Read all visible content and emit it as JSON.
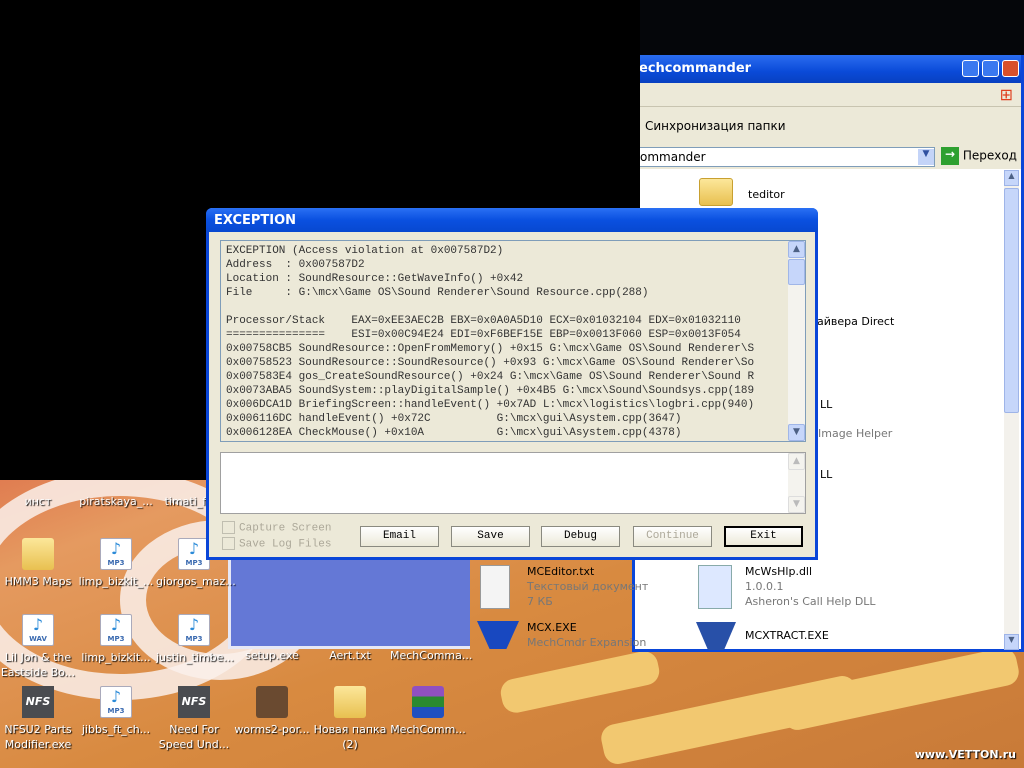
{
  "explorer": {
    "title": "echcommander",
    "toolbar_item": "Синхронизация папки",
    "address": "ommander",
    "go_label": "Переход",
    "items": [
      {
        "name": "teditor"
      },
      {
        "name": "айвера Direct"
      },
      {
        "name": "LL"
      },
      {
        "name": "Image Helper"
      },
      {
        "name": "LL"
      },
      {
        "name": "MCEditor.txt",
        "line2": "Текстовый документ",
        "line3": "7 КБ"
      },
      {
        "name": "McWsHlp.dll",
        "line2": "1.0.0.1",
        "line3": "Asheron's Call  Help DLL"
      },
      {
        "name": "MCX.EXE",
        "line2": "MechCmdr Expansion"
      },
      {
        "name": "MCXTRACT.EXE"
      }
    ]
  },
  "dialog": {
    "title": "EXCEPTION",
    "log": "EXCEPTION (Access violation at 0x007587D2)\nAddress  : 0x007587D2\nLocation : SoundResource::GetWaveInfo() +0x42\nFile     : G:\\mcx\\Game OS\\Sound Renderer\\Sound Resource.cpp(288)\n\nProcessor/Stack    EAX=0xEE3AEC2B EBX=0x0A0A5D10 ECX=0x01032104 EDX=0x01032110\n===============    ESI=0x00C94E24 EDI=0xF6BEF15E EBP=0x0013F060 ESP=0x0013F054\n0x00758CB5 SoundResource::OpenFromMemory() +0x15 G:\\mcx\\Game OS\\Sound Renderer\\S\n0x00758523 SoundResource::SoundResource() +0x93 G:\\mcx\\Game OS\\Sound Renderer\\So\n0x007583E4 gos_CreateSoundResource() +0x24 G:\\mcx\\Game OS\\Sound Renderer\\Sound R\n0x0073ABA5 SoundSystem::playDigitalSample() +0x4B5 G:\\mcx\\Sound\\Soundsys.cpp(189\n0x006DCA1D BriefingScreen::handleEvent() +0x7AD L:\\mcx\\logistics\\logbri.cpp(940)\n0x006116DC handleEvent() +0x72C          G:\\mcx\\gui\\Asystem.cpp(3647)\n0x006128EA CheckMouse() +0x10A           G:\\mcx\\gui\\Asystem.cpp(4378)",
    "capture_screen": "Capture Screen",
    "save_log_files": "Save Log Files",
    "buttons": {
      "email": "Email",
      "save": "Save",
      "debug": "Debug",
      "continue": "Continue",
      "exit": "Exit"
    }
  },
  "desktop": {
    "icons": [
      {
        "label": "инст",
        "type": "folder"
      },
      {
        "label": "piratskaya_...",
        "type": "mp3"
      },
      {
        "label": "timati_fe...",
        "type": "mp3"
      },
      {
        "label": "HMM3 Maps",
        "type": "folder"
      },
      {
        "label": "limp_bizkit_...",
        "type": "mp3"
      },
      {
        "label": "giorgos_maz...",
        "type": "mp3"
      },
      {
        "label": "Lil Jon & the Eastside Bo...",
        "type": "wav"
      },
      {
        "label": "limp_bizkit...",
        "type": "mp3"
      },
      {
        "label": "justin_timbe...",
        "type": "mp3"
      },
      {
        "label": "setup.exe",
        "type": "exe"
      },
      {
        "label": "Aert.txt",
        "type": "txt"
      },
      {
        "label": "MechComma...",
        "type": "exe"
      },
      {
        "label": "NFSU2 Parts Modifier.exe",
        "type": "nfs"
      },
      {
        "label": "jibbs_ft_ch...",
        "type": "mp3"
      },
      {
        "label": "Need For Speed Und...",
        "type": "nfs"
      },
      {
        "label": "worms2-por...",
        "type": "image"
      },
      {
        "label": "Новая папка (2)",
        "type": "folder"
      },
      {
        "label": "MechComm...",
        "type": "rar"
      }
    ],
    "icon_text": {
      "mp3": "MP3",
      "wav": "WAV",
      "nfs": "NFS"
    },
    "watermark": "www.VETTON.ru"
  },
  "colors": {
    "title_blue": "#0a50e0",
    "dialog_bg": "#ece9d8"
  }
}
